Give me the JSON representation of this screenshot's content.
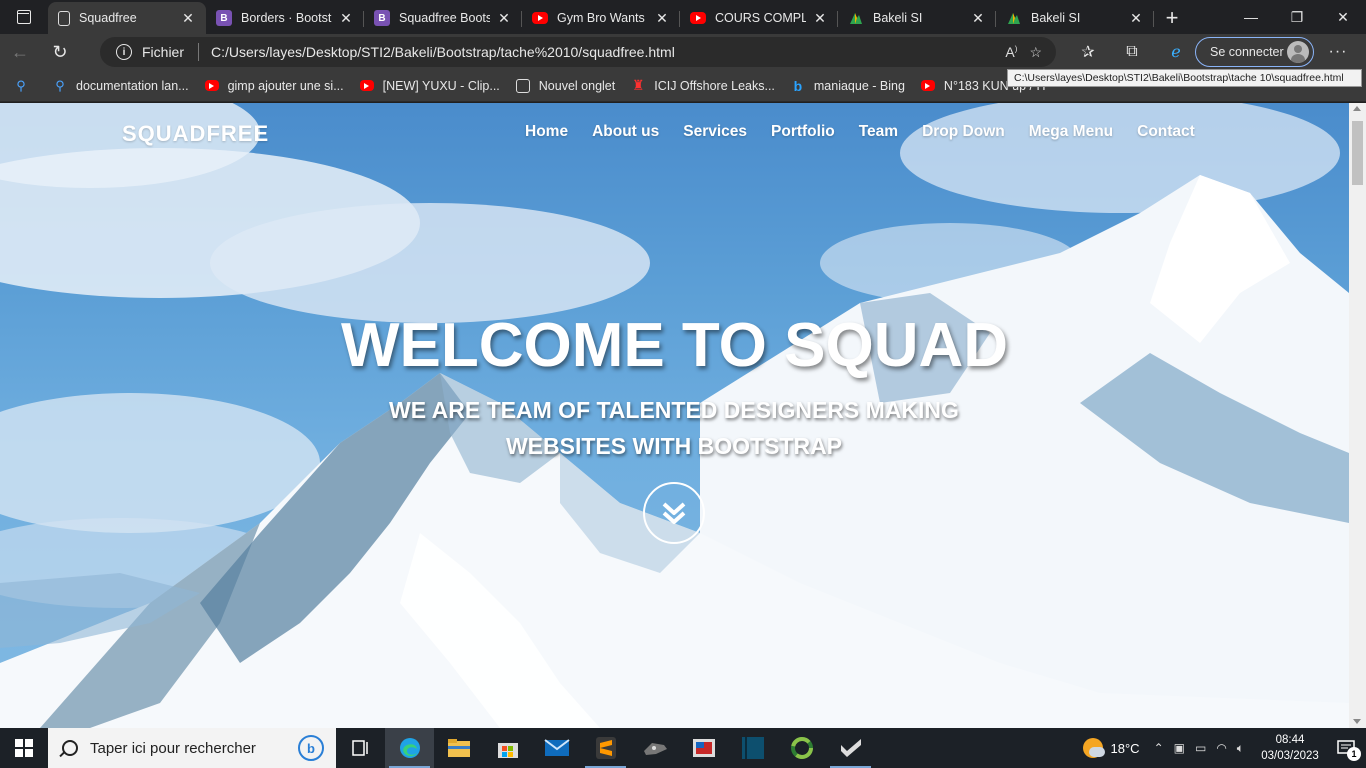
{
  "browser": {
    "tabs": [
      {
        "title": "Squadfree",
        "icon": "page-icon",
        "active": true
      },
      {
        "title": "Borders · Bootstra",
        "icon": "bootstrap-icon",
        "active": false
      },
      {
        "title": "Squadfree Bootstr",
        "icon": "bootstrap-icon",
        "active": false
      },
      {
        "title": "Gym Bro Wants W",
        "icon": "youtube-icon",
        "active": false
      },
      {
        "title": "COURS COMPLET",
        "icon": "youtube-icon",
        "active": false
      },
      {
        "title": "Bakeli SI",
        "icon": "bakeli-icon",
        "active": false
      },
      {
        "title": "Bakeli SI",
        "icon": "bakeli-icon",
        "active": false
      }
    ],
    "address": {
      "scheme_label": "Fichier",
      "url": "C:/Users/layes/Desktop/STI2/Bakeli/Bootstrap/tache%2010/squadfree.html"
    },
    "signin_label": "Se connecter",
    "favorites": [
      {
        "label": "",
        "icon": "search-icon"
      },
      {
        "label": "documentation lan...",
        "icon": "search-icon"
      },
      {
        "label": "gimp ajouter une si...",
        "icon": "youtube-icon"
      },
      {
        "label": "[NEW] YUXU - Clip...",
        "icon": "youtube-icon"
      },
      {
        "label": "Nouvel onglet",
        "icon": "newtab-icon"
      },
      {
        "label": "ICIJ Offshore Leaks...",
        "icon": "icij-icon"
      },
      {
        "label": "maniaque - Bing",
        "icon": "bing-icon"
      },
      {
        "label": "N°183 KUN up / H",
        "icon": "youtube-icon"
      }
    ],
    "tooltip": "C:\\Users\\layes\\Desktop\\STI2\\Bakeli\\Bootstrap\\tache 10\\squadfree.html"
  },
  "page": {
    "brand": "SQUADFREE",
    "nav": [
      "Home",
      "About us",
      "Services",
      "Portfolio",
      "Team",
      "Drop Down",
      "Mega Menu",
      "Contact"
    ],
    "hero": {
      "title": "WELCOME TO SQUAD",
      "subtitle": "WE ARE TEAM OF TALENTED DESIGNERS MAKING WEBSITES WITH BOOTSTRAP"
    }
  },
  "taskbar": {
    "search_placeholder": "Taper ici pour rechercher",
    "weather": "18°C",
    "time": "08:44",
    "date": "03/03/2023",
    "notification_count": "1"
  }
}
